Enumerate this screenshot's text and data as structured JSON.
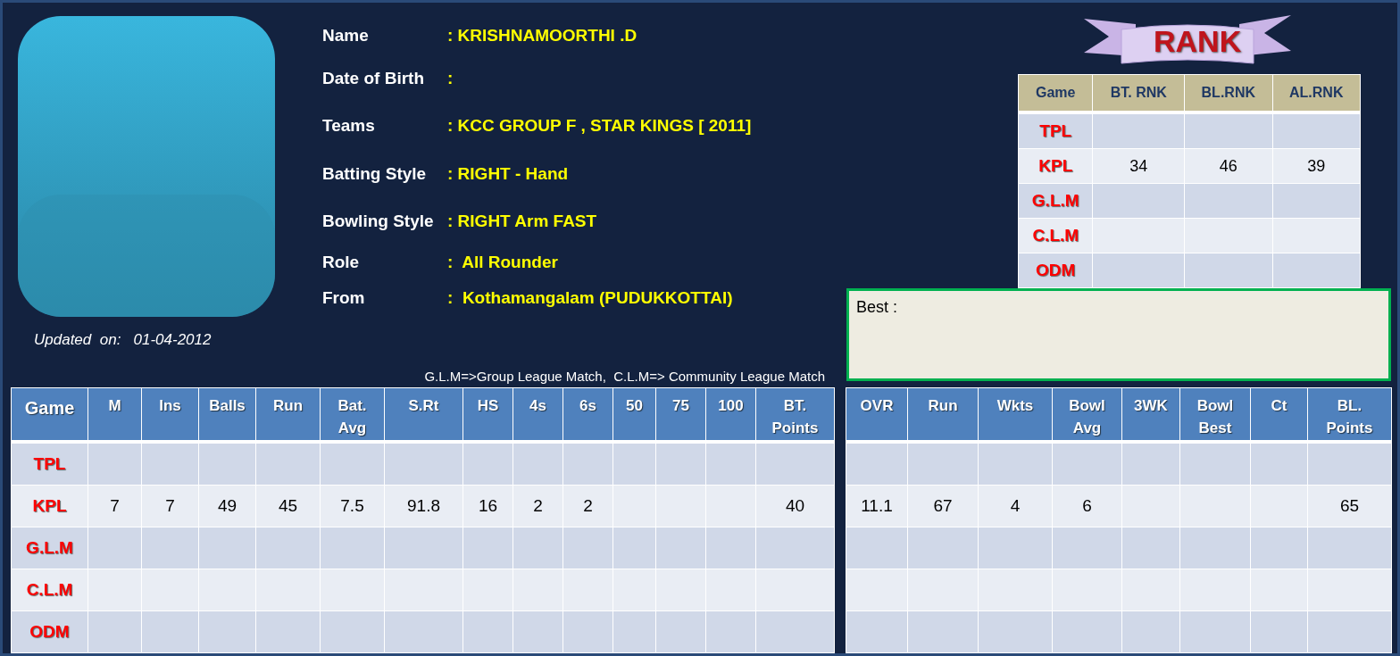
{
  "profile": {
    "updated": "Updated  on:   01-04-2012",
    "fields": [
      {
        "label": "Name",
        "value": ": KRISHNAMOORTHI .D"
      },
      {
        "label": "Date of Birth",
        "value": ":"
      },
      {
        "label": "Teams",
        "value": ": KCC GROUP F , STAR KINGS [ 2011]"
      },
      {
        "label": "Batting Style",
        "value": ": RIGHT - Hand"
      },
      {
        "label": "Bowling Style",
        "value": ": RIGHT Arm FAST"
      },
      {
        "label": "Role",
        "value": ":  All Rounder"
      },
      {
        "label": "From",
        "value": ":  Kothamangalam (PUDUKKOTTAI)"
      }
    ]
  },
  "rank": {
    "title": "RANK",
    "columns": [
      "Game",
      "BT. RNK",
      "BL.RNK",
      "AL.RNK"
    ],
    "rows": [
      [
        "TPL",
        "",
        "",
        ""
      ],
      [
        "KPL",
        "34",
        "46",
        "39"
      ],
      [
        "G.L.M",
        "",
        "",
        ""
      ],
      [
        "C.L.M",
        "",
        "",
        ""
      ],
      [
        "ODM",
        "",
        "",
        ""
      ]
    ]
  },
  "best": {
    "label": "Best :"
  },
  "legend": "G.L.M=>Group League Match,  C.L.M=> Community League Match",
  "batting": {
    "columns": [
      "Game",
      "M",
      "Ins",
      "Balls",
      "Run",
      "Bat. Avg",
      "S.Rt",
      "HS",
      "4s",
      "6s",
      "50",
      "75",
      "100",
      "BT. Points"
    ],
    "rows": [
      [
        "TPL",
        "",
        "",
        "",
        "",
        "",
        "",
        "",
        "",
        "",
        "",
        "",
        "",
        ""
      ],
      [
        "KPL",
        "7",
        "7",
        "49",
        "45",
        "7.5",
        "91.8",
        "16",
        "2",
        "2",
        "",
        "",
        "",
        "40"
      ],
      [
        "G.L.M",
        "",
        "",
        "",
        "",
        "",
        "",
        "",
        "",
        "",
        "",
        "",
        "",
        ""
      ],
      [
        "C.L.M",
        "",
        "",
        "",
        "",
        "",
        "",
        "",
        "",
        "",
        "",
        "",
        "",
        ""
      ],
      [
        "ODM",
        "",
        "",
        "",
        "",
        "",
        "",
        "",
        "",
        "",
        "",
        "",
        "",
        ""
      ]
    ]
  },
  "bowling": {
    "columns": [
      "OVR",
      "Run",
      "Wkts",
      "Bowl Avg",
      "3WK",
      "Bowl Best",
      "Ct",
      "BL. Points"
    ],
    "rows": [
      [
        "",
        "",
        "",
        "",
        "",
        "",
        "",
        ""
      ],
      [
        "11.1",
        "67",
        "4",
        "6",
        "",
        "",
        "",
        "65"
      ],
      [
        "",
        "",
        "",
        "",
        "",
        "",
        "",
        ""
      ],
      [
        "",
        "",
        "",
        "",
        "",
        "",
        "",
        ""
      ],
      [
        "",
        "",
        "",
        "",
        "",
        "",
        "",
        ""
      ]
    ]
  }
}
